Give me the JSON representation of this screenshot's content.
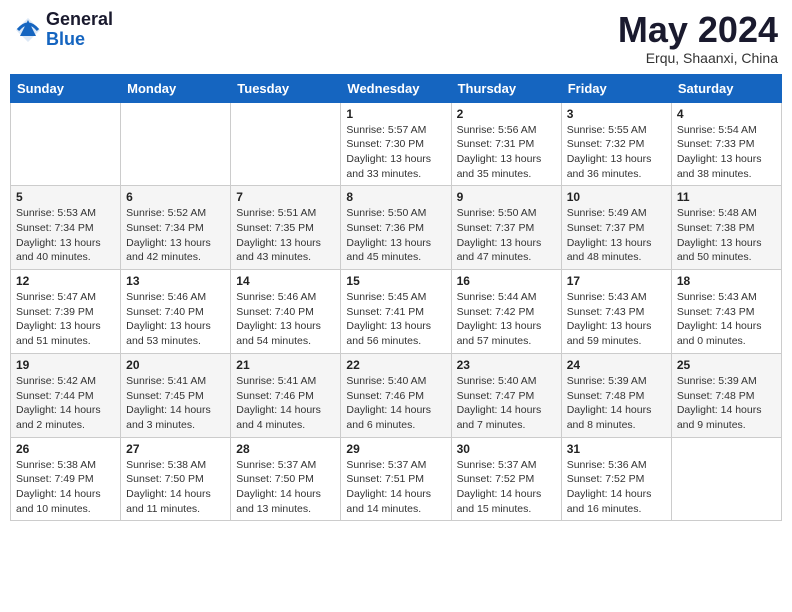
{
  "header": {
    "logo_general": "General",
    "logo_blue": "Blue",
    "month_year": "May 2024",
    "location": "Erqu, Shaanxi, China"
  },
  "days_of_week": [
    "Sunday",
    "Monday",
    "Tuesday",
    "Wednesday",
    "Thursday",
    "Friday",
    "Saturday"
  ],
  "weeks": [
    [
      {
        "day": "",
        "info": ""
      },
      {
        "day": "",
        "info": ""
      },
      {
        "day": "",
        "info": ""
      },
      {
        "day": "1",
        "info": "Sunrise: 5:57 AM\nSunset: 7:30 PM\nDaylight: 13 hours\nand 33 minutes."
      },
      {
        "day": "2",
        "info": "Sunrise: 5:56 AM\nSunset: 7:31 PM\nDaylight: 13 hours\nand 35 minutes."
      },
      {
        "day": "3",
        "info": "Sunrise: 5:55 AM\nSunset: 7:32 PM\nDaylight: 13 hours\nand 36 minutes."
      },
      {
        "day": "4",
        "info": "Sunrise: 5:54 AM\nSunset: 7:33 PM\nDaylight: 13 hours\nand 38 minutes."
      }
    ],
    [
      {
        "day": "5",
        "info": "Sunrise: 5:53 AM\nSunset: 7:34 PM\nDaylight: 13 hours\nand 40 minutes."
      },
      {
        "day": "6",
        "info": "Sunrise: 5:52 AM\nSunset: 7:34 PM\nDaylight: 13 hours\nand 42 minutes."
      },
      {
        "day": "7",
        "info": "Sunrise: 5:51 AM\nSunset: 7:35 PM\nDaylight: 13 hours\nand 43 minutes."
      },
      {
        "day": "8",
        "info": "Sunrise: 5:50 AM\nSunset: 7:36 PM\nDaylight: 13 hours\nand 45 minutes."
      },
      {
        "day": "9",
        "info": "Sunrise: 5:50 AM\nSunset: 7:37 PM\nDaylight: 13 hours\nand 47 minutes."
      },
      {
        "day": "10",
        "info": "Sunrise: 5:49 AM\nSunset: 7:37 PM\nDaylight: 13 hours\nand 48 minutes."
      },
      {
        "day": "11",
        "info": "Sunrise: 5:48 AM\nSunset: 7:38 PM\nDaylight: 13 hours\nand 50 minutes."
      }
    ],
    [
      {
        "day": "12",
        "info": "Sunrise: 5:47 AM\nSunset: 7:39 PM\nDaylight: 13 hours\nand 51 minutes."
      },
      {
        "day": "13",
        "info": "Sunrise: 5:46 AM\nSunset: 7:40 PM\nDaylight: 13 hours\nand 53 minutes."
      },
      {
        "day": "14",
        "info": "Sunrise: 5:46 AM\nSunset: 7:40 PM\nDaylight: 13 hours\nand 54 minutes."
      },
      {
        "day": "15",
        "info": "Sunrise: 5:45 AM\nSunset: 7:41 PM\nDaylight: 13 hours\nand 56 minutes."
      },
      {
        "day": "16",
        "info": "Sunrise: 5:44 AM\nSunset: 7:42 PM\nDaylight: 13 hours\nand 57 minutes."
      },
      {
        "day": "17",
        "info": "Sunrise: 5:43 AM\nSunset: 7:43 PM\nDaylight: 13 hours\nand 59 minutes."
      },
      {
        "day": "18",
        "info": "Sunrise: 5:43 AM\nSunset: 7:43 PM\nDaylight: 14 hours\nand 0 minutes."
      }
    ],
    [
      {
        "day": "19",
        "info": "Sunrise: 5:42 AM\nSunset: 7:44 PM\nDaylight: 14 hours\nand 2 minutes."
      },
      {
        "day": "20",
        "info": "Sunrise: 5:41 AM\nSunset: 7:45 PM\nDaylight: 14 hours\nand 3 minutes."
      },
      {
        "day": "21",
        "info": "Sunrise: 5:41 AM\nSunset: 7:46 PM\nDaylight: 14 hours\nand 4 minutes."
      },
      {
        "day": "22",
        "info": "Sunrise: 5:40 AM\nSunset: 7:46 PM\nDaylight: 14 hours\nand 6 minutes."
      },
      {
        "day": "23",
        "info": "Sunrise: 5:40 AM\nSunset: 7:47 PM\nDaylight: 14 hours\nand 7 minutes."
      },
      {
        "day": "24",
        "info": "Sunrise: 5:39 AM\nSunset: 7:48 PM\nDaylight: 14 hours\nand 8 minutes."
      },
      {
        "day": "25",
        "info": "Sunrise: 5:39 AM\nSunset: 7:48 PM\nDaylight: 14 hours\nand 9 minutes."
      }
    ],
    [
      {
        "day": "26",
        "info": "Sunrise: 5:38 AM\nSunset: 7:49 PM\nDaylight: 14 hours\nand 10 minutes."
      },
      {
        "day": "27",
        "info": "Sunrise: 5:38 AM\nSunset: 7:50 PM\nDaylight: 14 hours\nand 11 minutes."
      },
      {
        "day": "28",
        "info": "Sunrise: 5:37 AM\nSunset: 7:50 PM\nDaylight: 14 hours\nand 13 minutes."
      },
      {
        "day": "29",
        "info": "Sunrise: 5:37 AM\nSunset: 7:51 PM\nDaylight: 14 hours\nand 14 minutes."
      },
      {
        "day": "30",
        "info": "Sunrise: 5:37 AM\nSunset: 7:52 PM\nDaylight: 14 hours\nand 15 minutes."
      },
      {
        "day": "31",
        "info": "Sunrise: 5:36 AM\nSunset: 7:52 PM\nDaylight: 14 hours\nand 16 minutes."
      },
      {
        "day": "",
        "info": ""
      }
    ]
  ]
}
